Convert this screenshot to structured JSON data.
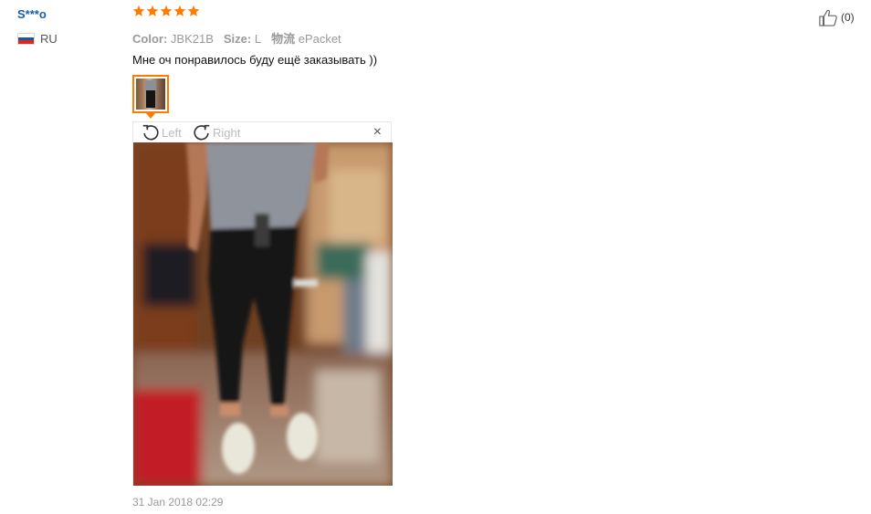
{
  "review": {
    "user_name": "S***o",
    "country_code": "RU",
    "flag_colors": [
      "#ffffff",
      "#1c57a7",
      "#d52b1e"
    ],
    "rating": 5,
    "star_color": "#ff7a00",
    "attributes": [
      {
        "key": "Color:",
        "value": "JBK21B"
      },
      {
        "key": "Size:",
        "value": "L"
      },
      {
        "key": "物流",
        "value": "ePacket"
      }
    ],
    "text": "Мне оч понравилось буду ещё заказывать ))",
    "date": "31 Jan 2018 02:29",
    "like_count": "(0)"
  },
  "viewer": {
    "rotate_left_label": "Left",
    "rotate_right_label": "Right",
    "close_symbol": "×",
    "accent_color": "#ff7a00",
    "icons": [
      "rotate-left-icon",
      "rotate-right-icon",
      "close-icon",
      "thumbs-up-icon",
      "star-icon"
    ]
  }
}
